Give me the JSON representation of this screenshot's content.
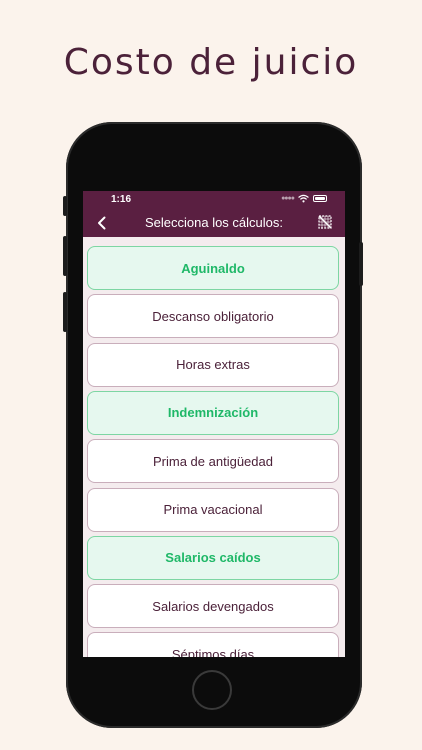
{
  "headline": "Costo de juicio",
  "status_bar": {
    "time": "1:16"
  },
  "nav": {
    "title": "Selecciona los cálculos:"
  },
  "calculations": [
    {
      "label": "Aguinaldo",
      "selected": true
    },
    {
      "label": "Descanso obligatorio",
      "selected": false
    },
    {
      "label": "Horas extras",
      "selected": false
    },
    {
      "label": "Indemnización",
      "selected": true
    },
    {
      "label": "Prima de antigüedad",
      "selected": false
    },
    {
      "label": "Prima vacacional",
      "selected": false
    },
    {
      "label": "Salarios caídos",
      "selected": true
    },
    {
      "label": "Salarios devengados",
      "selected": false
    },
    {
      "label": "Séptimos días",
      "selected": false
    }
  ],
  "colors": {
    "page_background": "#fbf3ec",
    "brand_header": "#5a1f41",
    "selected_text": "#1fb868",
    "selected_background": "#e6f8ef",
    "unselected_text": "#4b2139"
  }
}
